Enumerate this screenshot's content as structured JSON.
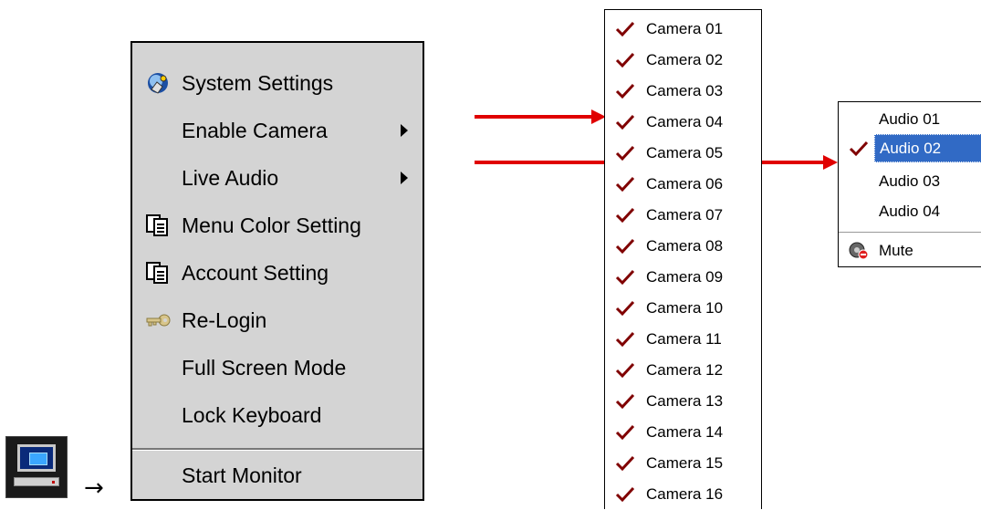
{
  "flow_arrow": "→",
  "main_menu": {
    "items": [
      {
        "label": "System Settings",
        "icon": "system-settings-icon"
      },
      {
        "label": "Enable Camera",
        "submenu": true
      },
      {
        "label": "Live Audio",
        "submenu": true
      },
      {
        "label": "Menu Color Setting",
        "icon": "document-icon"
      },
      {
        "label": "Account Setting",
        "icon": "document-icon"
      },
      {
        "label": "Re-Login",
        "icon": "key-icon"
      },
      {
        "label": "Full Screen Mode"
      },
      {
        "label": "Lock Keyboard"
      },
      {
        "label": "Start Monitor"
      }
    ]
  },
  "camera_menu": {
    "items": [
      {
        "label": "Camera 01",
        "checked": true
      },
      {
        "label": "Camera 02",
        "checked": true
      },
      {
        "label": "Camera 03",
        "checked": true
      },
      {
        "label": "Camera 04",
        "checked": true
      },
      {
        "label": "Camera 05",
        "checked": true
      },
      {
        "label": "Camera 06",
        "checked": true
      },
      {
        "label": "Camera 07",
        "checked": true
      },
      {
        "label": "Camera 08",
        "checked": true
      },
      {
        "label": "Camera 09",
        "checked": true
      },
      {
        "label": "Camera 10",
        "checked": true
      },
      {
        "label": "Camera 11",
        "checked": true
      },
      {
        "label": "Camera 12",
        "checked": true
      },
      {
        "label": "Camera 13",
        "checked": true
      },
      {
        "label": "Camera 14",
        "checked": true
      },
      {
        "label": "Camera 15",
        "checked": true
      },
      {
        "label": "Camera 16",
        "checked": true
      }
    ]
  },
  "audio_menu": {
    "items": [
      {
        "label": "Audio 01",
        "checked": false
      },
      {
        "label": "Audio 02",
        "checked": true,
        "selected": true
      },
      {
        "label": "Audio 03",
        "checked": false
      },
      {
        "label": "Audio 04",
        "checked": false
      }
    ],
    "mute_label": "Mute"
  },
  "colors": {
    "arrow": "#e00000",
    "check": "#800000",
    "selection": "#316ac5",
    "menu_bg": "#d4d4d4"
  }
}
